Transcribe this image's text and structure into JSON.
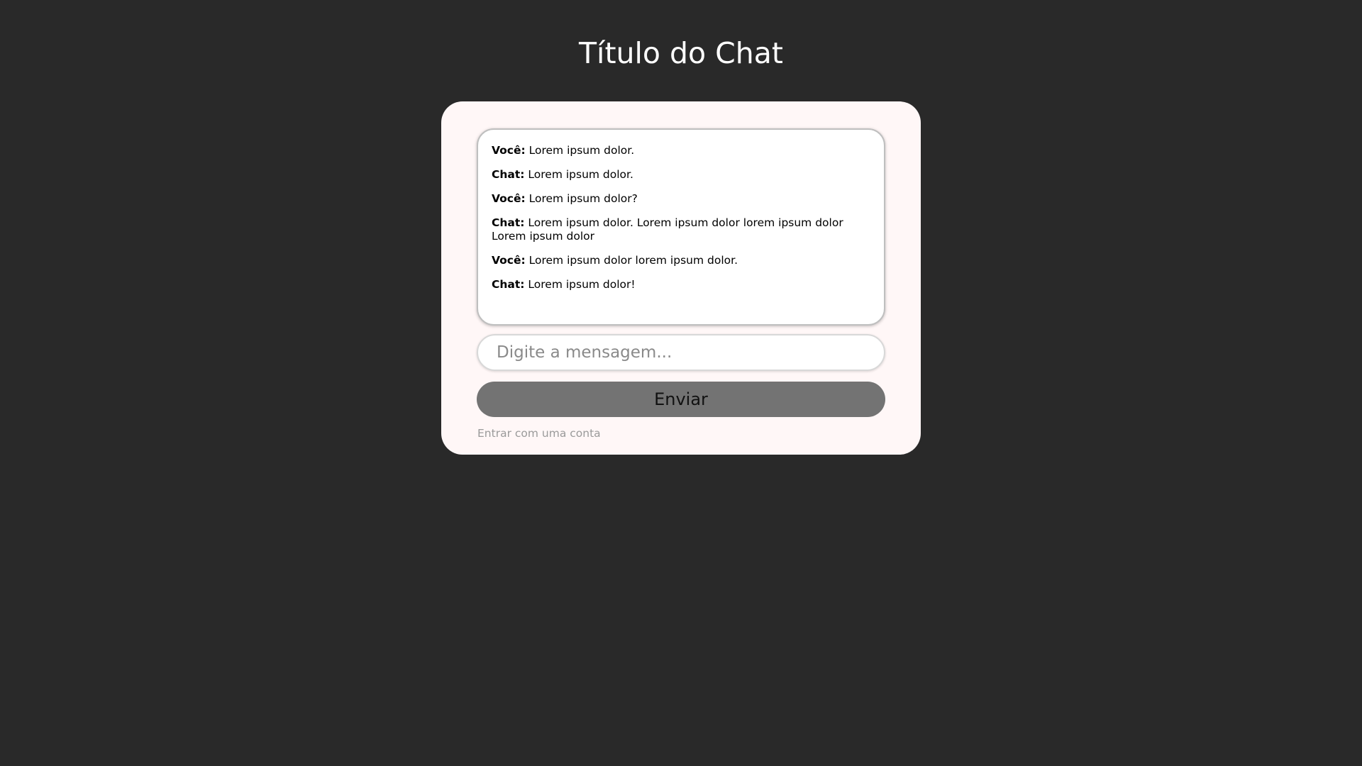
{
  "page": {
    "title": "Título do Chat"
  },
  "messages": [
    {
      "sender": "Você:",
      "text": " Lorem ipsum dolor."
    },
    {
      "sender": "Chat:",
      "text": " Lorem ipsum dolor."
    },
    {
      "sender": "Você:",
      "text": " Lorem ipsum dolor?"
    },
    {
      "sender": "Chat:",
      "text": " Lorem ipsum dolor. Lorem ipsum dolor lorem ipsum dolor Lorem ipsum dolor"
    },
    {
      "sender": "Você:",
      "text": " Lorem ipsum dolor lorem ipsum dolor."
    },
    {
      "sender": "Chat:",
      "text": " Lorem ipsum dolor!"
    }
  ],
  "input": {
    "placeholder": "Digite a mensagem...",
    "value": ""
  },
  "send_button": {
    "label": "Enviar"
  },
  "login_link": {
    "label": "Entrar com uma conta"
  },
  "colors": {
    "background": "#292929",
    "card": "#fff7f7",
    "button": "#737373"
  }
}
